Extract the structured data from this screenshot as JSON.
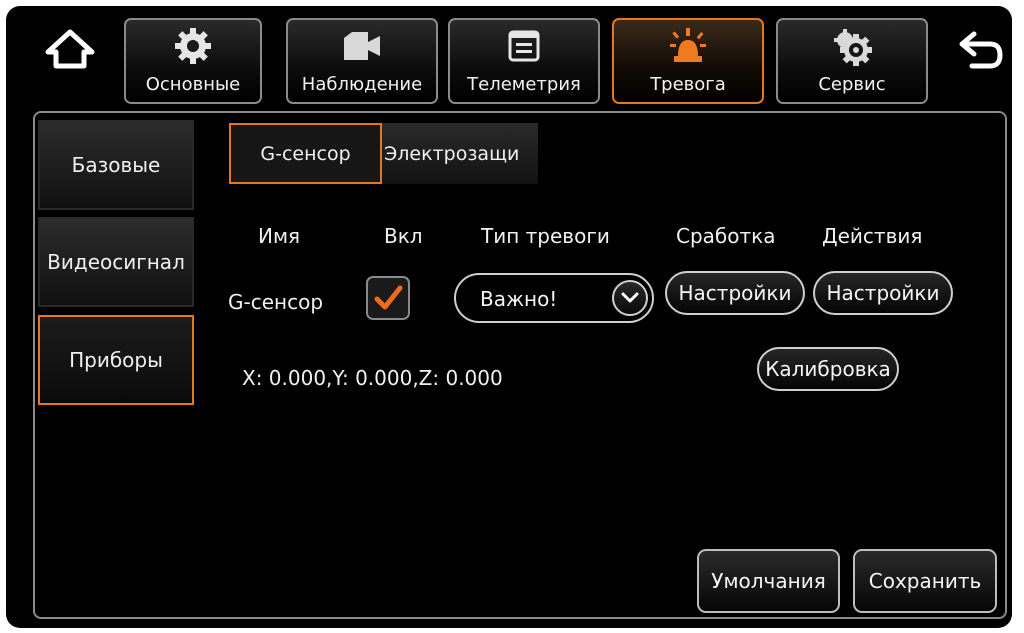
{
  "top_bar": {
    "home_icon": "home-icon",
    "back_icon": "back-arrow-icon",
    "tabs": [
      {
        "label": "Основные",
        "icon": "gear-icon",
        "active": false
      },
      {
        "label": "Наблюдение",
        "icon": "camera-icon",
        "active": false
      },
      {
        "label": "Телеметрия",
        "icon": "document-icon",
        "active": false
      },
      {
        "label": "Тревога",
        "icon": "alarm-siren-icon",
        "active": true
      },
      {
        "label": "Сервис",
        "icon": "gears-icon",
        "active": false
      }
    ]
  },
  "sidebar": {
    "items": [
      {
        "label": "Базовые",
        "active": false
      },
      {
        "label": "Видеосигнал",
        "active": false
      },
      {
        "label": "Приборы",
        "active": true
      }
    ]
  },
  "subtabs": [
    {
      "label": "G-сенсор",
      "active": true
    },
    {
      "label": "Электрозащи",
      "active": false
    }
  ],
  "table": {
    "headers": {
      "name": "Имя",
      "enable": "Вкл",
      "alarm_type": "Тип тревоги",
      "trigger": "Сработка",
      "actions": "Действия"
    },
    "row": {
      "name": "G-сенсор",
      "enabled": true,
      "alarm_type": "Важно!",
      "trigger_button": "Настройки",
      "actions_button": "Настройки"
    }
  },
  "readout": "X: 0.000,Y: 0.000,Z: 0.000",
  "calibrate_button": "Калибровка",
  "footer": {
    "defaults_button": "Умолчания",
    "save_button": "Сохранить"
  },
  "colors": {
    "accent": "#e8761d",
    "check": "#f06a1e",
    "background": "#000000",
    "border": "#8a8a8a"
  }
}
